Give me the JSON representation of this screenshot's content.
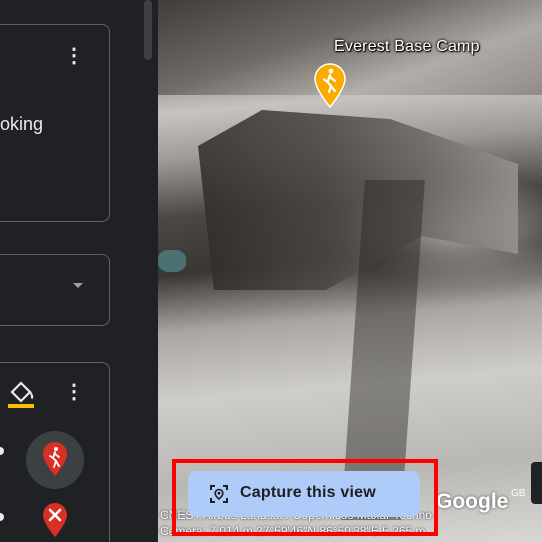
{
  "left_panel": {
    "card1_text": "oking",
    "card1_menu": "⋮",
    "card3_menu": "⋮"
  },
  "map": {
    "place_label": "Everest Base Camp",
    "attribution": "CNES / Airbus Landsat / Copernicus Maxar Techno",
    "camera_readout": "Camera: 7,014 m  27°59'46\"N 86°50'38\"E  5,265 m",
    "logo_text": "Google",
    "region_label": "GB"
  },
  "capture": {
    "label": "Capture this view"
  },
  "colors": {
    "panel_bg": "#202124",
    "button_bg": "#aecbfa",
    "highlight": "#ff0000",
    "pin_red": "#d93025",
    "pin_yellow": "#f9ab00"
  }
}
